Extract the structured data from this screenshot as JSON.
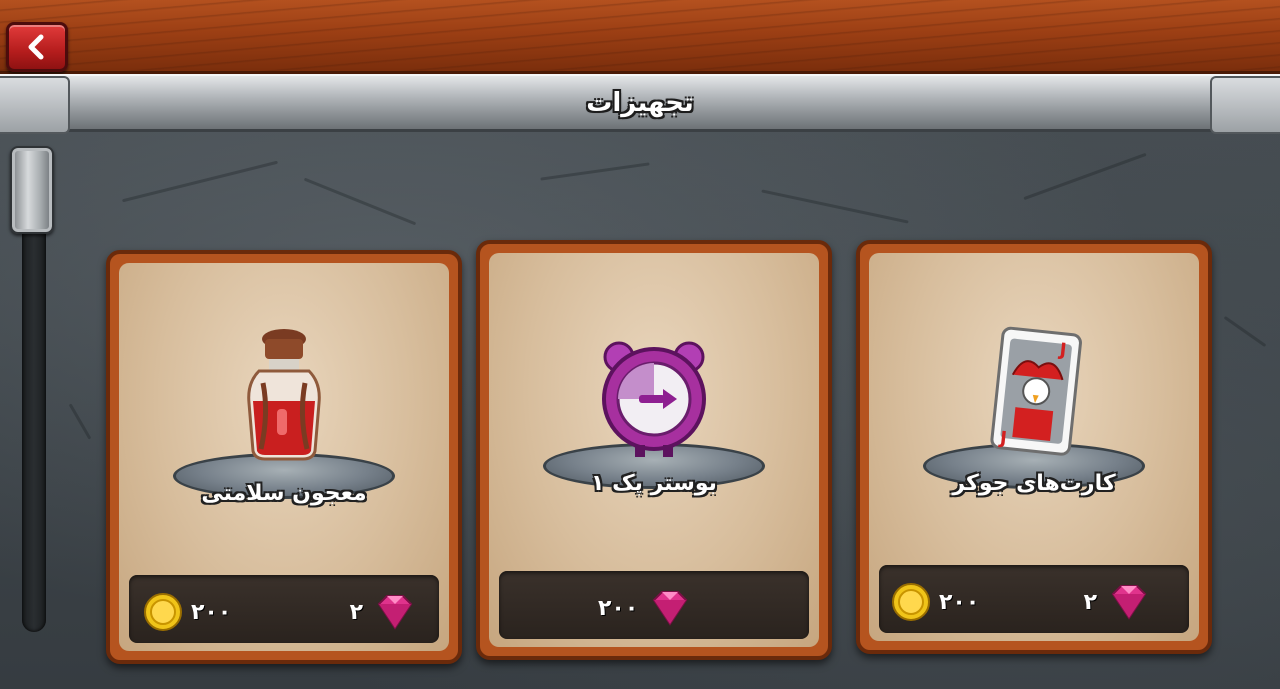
{
  "header": {
    "back_icon": "chevron-left-icon",
    "title": "تجهیزات"
  },
  "colors": {
    "wood": "#9c3f14",
    "back_button": "#c62828",
    "card_frame": "#b5541f",
    "card_bg": "#e1c9aa",
    "price_panel": "#2f2722",
    "gem": "#e0338c",
    "coin": "#f0c419"
  },
  "cards": [
    {
      "name": "معجون سلامتی",
      "icon": "health-potion-icon",
      "prices": [
        {
          "currency": "gem-icon",
          "value": "۲"
        },
        {
          "currency": "coin-icon",
          "value": "۲۰۰"
        }
      ]
    },
    {
      "name": "بوستر پک ۱",
      "icon": "booster-clock-icon",
      "prices": [
        {
          "currency": "gem-icon",
          "value": "۲۰۰"
        }
      ]
    },
    {
      "name": "کارت‌های جوکر",
      "icon": "joker-card-icon",
      "prices": [
        {
          "currency": "gem-icon",
          "value": "۲"
        },
        {
          "currency": "coin-icon",
          "value": "۲۰۰"
        }
      ]
    }
  ]
}
